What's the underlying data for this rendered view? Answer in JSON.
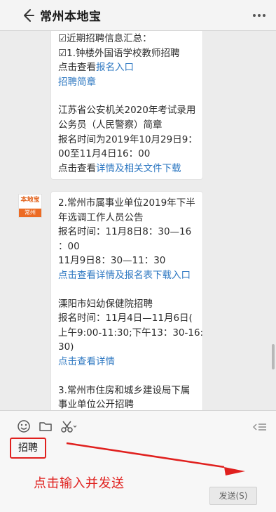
{
  "header": {
    "title": "常州本地宝"
  },
  "messages": [
    {
      "lines": [
        {
          "text": "☑近期招聘信息汇总：",
          "link": false
        },
        {
          "text": "☑1.钟楼外国语学校教师招聘",
          "link": false
        },
        {
          "prefix": "点击查看",
          "text": "报名入口",
          "link": true
        },
        {
          "text": "招聘简章",
          "link": true
        },
        {
          "gap": true
        },
        {
          "text": "江苏省公安机关2020年考试录用",
          "link": false
        },
        {
          "text": "公务员（人民警察）简章",
          "link": false
        },
        {
          "text": "报名时间为2019年10月29日9：",
          "link": false
        },
        {
          "text": "00至11月4日16：00",
          "link": false
        },
        {
          "prefix": "点击查看",
          "text": "详情及相关文件下载",
          "link": true
        }
      ]
    },
    {
      "lines": [
        {
          "text": "2.常州市属事业单位2019年下半",
          "link": false
        },
        {
          "text": "年选调工作人员公告",
          "link": false
        },
        {
          "text": "报名时间：11月8日8：30—16",
          "link": false
        },
        {
          "text": "：00",
          "link": false
        },
        {
          "text": "11月9日8：30—11：30",
          "link": false
        },
        {
          "text": "点击查看详情及报名表下载入口",
          "link": true
        },
        {
          "gap": true
        },
        {
          "text": "溧阳市妇幼保健院招聘",
          "link": false
        },
        {
          "text": "报名时间：11月4日—11月6日(",
          "link": false
        },
        {
          "text": "上午9:00-11:30;下午13：30-16:",
          "link": false
        },
        {
          "text": "30)",
          "link": false
        },
        {
          "text": "点击查看详情",
          "link": true
        },
        {
          "gap": true
        },
        {
          "text": "3.常州市住房和城乡建设局下属",
          "link": false
        },
        {
          "text": "事业单位公开招聘",
          "link": false
        }
      ]
    }
  ],
  "avatar": {
    "top_text": "本地宝",
    "bottom_text": "常州"
  },
  "input": {
    "typed_text": "招聘",
    "annotation": "点击输入并发送",
    "send_label": "发送(S)"
  },
  "icons": {
    "back": "back-arrow-icon",
    "more": "more-icon",
    "emoji": "emoji-icon",
    "folder": "folder-icon",
    "scissors": "scissors-icon",
    "collapse": "collapse-icon"
  },
  "colors": {
    "link": "#2e78c2",
    "annotation": "#e0201e",
    "avatar_accent": "#ec6b24"
  }
}
